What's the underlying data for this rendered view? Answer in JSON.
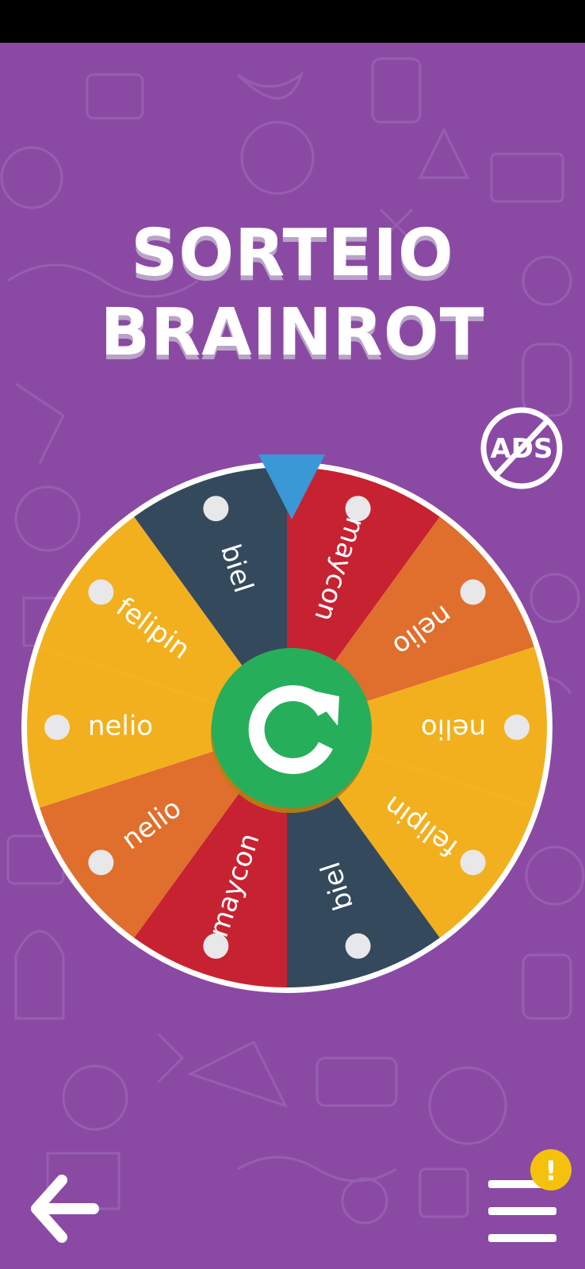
{
  "app": {
    "title_line1": "SORTEIO",
    "title_line2": "BRAINROT"
  },
  "ads_button": {
    "label": "ADS"
  },
  "wheel": {
    "colors": {
      "orange": "#e06e2c",
      "yellow": "#f2b01e",
      "navy": "#34495c",
      "red": "#c72231",
      "spin_green": "#27ae5a",
      "pointer_blue": "#3a98d6"
    },
    "segments": [
      {
        "label": "felipin",
        "color": "#f2b01e"
      },
      {
        "label": "biel",
        "color": "#34495c"
      },
      {
        "label": "maycon",
        "color": "#c72231"
      },
      {
        "label": "nelio",
        "color": "#e06e2c"
      },
      {
        "label": "nelio",
        "color": "#f2b01e"
      },
      {
        "label": "felipin",
        "color": "#f2b01e"
      },
      {
        "label": "biel",
        "color": "#34495c"
      },
      {
        "label": "maycon",
        "color": "#c72231"
      },
      {
        "label": "nelio",
        "color": "#e06e2c"
      },
      {
        "label": "nelio",
        "color": "#f2b01e"
      }
    ],
    "spin_button_icon": "refresh-icon",
    "pointer_icon": "triangle-pointer-icon"
  },
  "nav": {
    "back_icon": "arrow-left-icon",
    "menu_icon": "hamburger-menu-icon",
    "alert_badge": {
      "label": "!",
      "color": "#f4c20d"
    }
  },
  "background": {
    "color": "#8a4aa4"
  }
}
